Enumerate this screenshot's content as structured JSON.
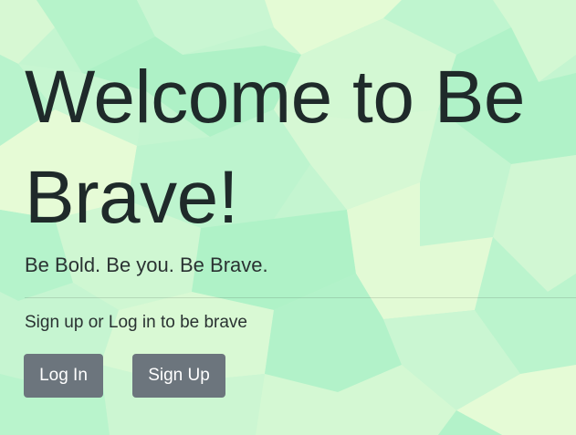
{
  "page": {
    "background_colors": [
      "#c4f5d0",
      "#aef2c8",
      "#d6f8d4",
      "#e6fbd6",
      "#b8f3cc",
      "#ccf6d2"
    ]
  },
  "hero": {
    "title": "Welcome to Be Brave!",
    "lead": "Be Bold. Be you. Be Brave.",
    "prompt": "Sign up or Log in to be brave"
  },
  "actions": {
    "login_label": "Log In",
    "signup_label": "Sign Up",
    "button_color": "#6c757d"
  }
}
